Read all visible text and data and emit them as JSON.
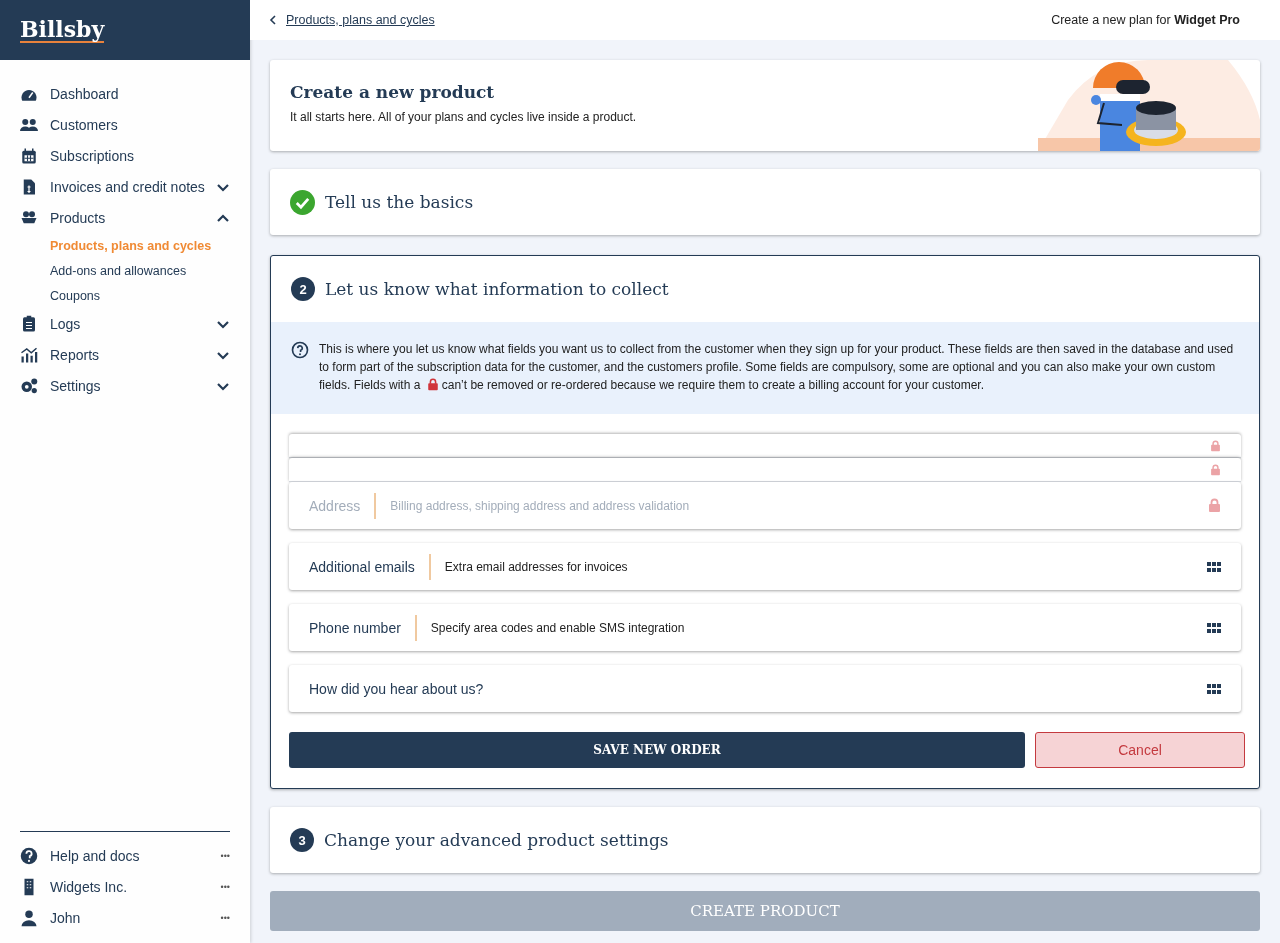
{
  "brand": {
    "logo": "Billsby"
  },
  "sidebar": {
    "items": [
      {
        "label": "Dashboard"
      },
      {
        "label": "Customers"
      },
      {
        "label": "Subscriptions"
      },
      {
        "label": "Invoices and credit notes",
        "expanded": false
      },
      {
        "label": "Products",
        "expanded": true,
        "children": [
          {
            "label": "Products, plans and cycles",
            "selected": true
          },
          {
            "label": "Add-ons and allowances",
            "selected": false
          },
          {
            "label": "Coupons",
            "selected": false
          }
        ]
      },
      {
        "label": "Logs",
        "expanded": false
      },
      {
        "label": "Reports",
        "expanded": false
      },
      {
        "label": "Settings",
        "expanded": false
      }
    ],
    "footer_items": [
      {
        "label": "Help and docs",
        "more": "•••"
      },
      {
        "label": "Widgets Inc.",
        "more": "•••"
      },
      {
        "label": "John",
        "more": "•••"
      }
    ]
  },
  "topbar": {
    "back_link": "Products, plans and cycles",
    "context": "Create a new plan for **Widget Pro**"
  },
  "intro_card": {
    "title": "Create a new product",
    "subtitle": "It all starts here. All of your plans and cycles live inside a product."
  },
  "steps": [
    {
      "title": "Tell us the basics",
      "completed": true,
      "active": false
    },
    {
      "number": "2",
      "title": "Let us know what information to collect",
      "completed": false,
      "active": true
    },
    {
      "number": "3",
      "title": "Change your advanced product settings",
      "completed": false,
      "active": false
    }
  ],
  "info_box": {
    "text_before_lock": "This is where you let us know what fields you want us to collect from the customer when they sign up for your product. These fields are then saved in the database and used to form part of the subscription data for the customer, and the customers profile. Some fields are compulsory, some are optional and you can also make your own custom fields. Fields with a",
    "text_after_lock": "can’t be removed or re-ordered because we require them to create a billing account for your customer."
  },
  "fields": [
    {
      "locked": true,
      "stacked": true
    },
    {
      "locked": true,
      "stacked": true
    },
    {
      "label": "Address",
      "description": "Billing address, shipping address and address validation",
      "locked": true,
      "stacked": false
    },
    {
      "label": "Additional emails",
      "description": "Extra email addresses for invoices",
      "locked": false,
      "stacked": false
    },
    {
      "label": "Phone number",
      "description": "Specify area codes and enable SMS integration",
      "locked": false,
      "stacked": false
    },
    {
      "label": "How did you hear about us?",
      "locked": false,
      "stacked": false
    }
  ],
  "buttons": {
    "save": "SAVE NEW ORDER",
    "cancel": "Cancel"
  },
  "create_button": {
    "label": "CREATE PRODUCT",
    "disabled": true
  }
}
